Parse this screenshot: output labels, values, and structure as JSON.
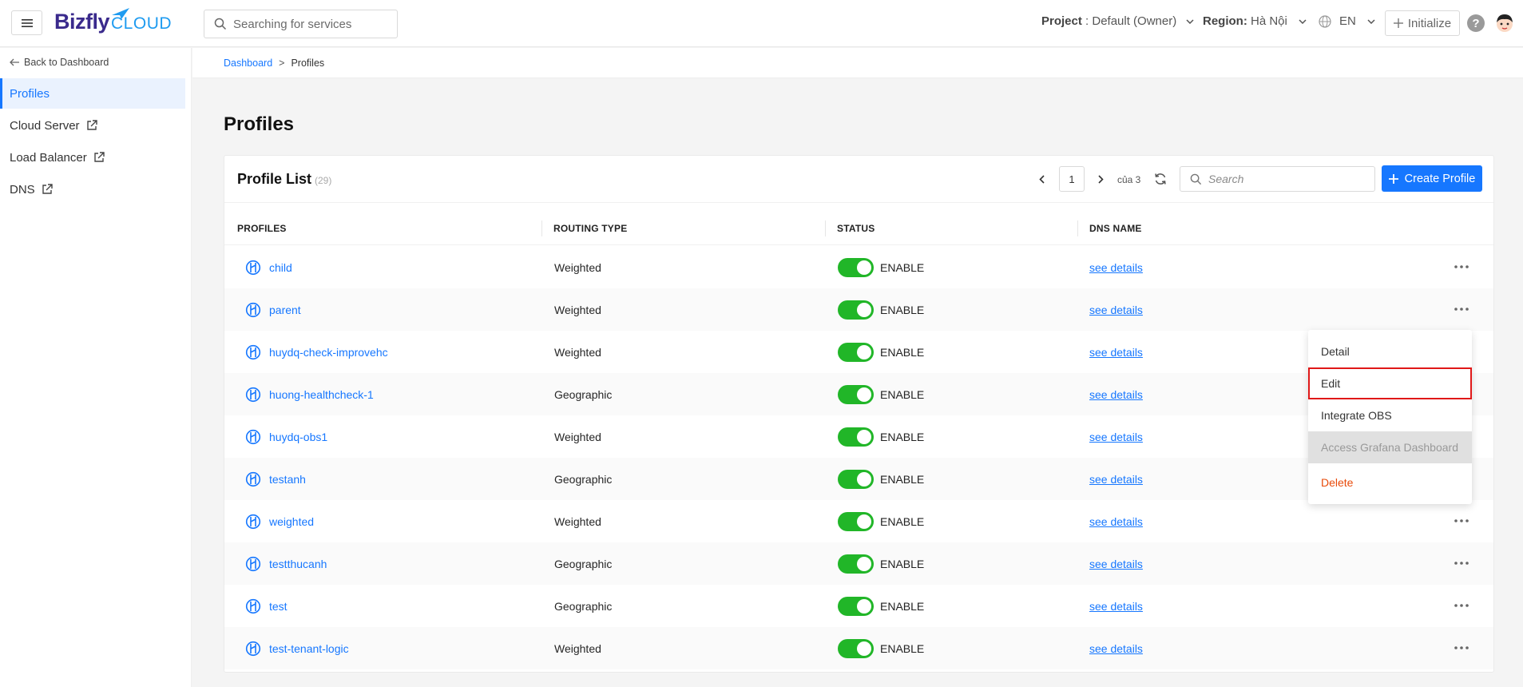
{
  "header": {
    "logo_main": "Bizfly",
    "logo_sub": "CLOUD",
    "search_placeholder": "Searching for services",
    "project_label": "Project",
    "project_value": " : Default (Owner)",
    "region_label": "Region:",
    "region_value": " Hà Nội",
    "language": "EN",
    "initialize_label": "Initialize"
  },
  "sidebar": {
    "back_label": "Back to Dashboard",
    "items": [
      {
        "label": "Profiles",
        "external": false,
        "active": true
      },
      {
        "label": "Cloud Server",
        "external": true,
        "active": false
      },
      {
        "label": "Load Balancer",
        "external": true,
        "active": false
      },
      {
        "label": "DNS",
        "external": true,
        "active": false
      }
    ]
  },
  "breadcrumb": {
    "root": "Dashboard",
    "separator": ">",
    "current": "Profiles"
  },
  "page": {
    "title": "Profiles"
  },
  "list": {
    "title": "Profile List",
    "count": "(29)",
    "current_page": "1",
    "of_text": "của 3",
    "search_placeholder": "Search",
    "create_label": "Create Profile",
    "columns": [
      "PROFILES",
      "ROUTING TYPE",
      "STATUS",
      "DNS NAME"
    ],
    "rows": [
      {
        "name": "child",
        "routing": "Weighted",
        "status": "ENABLE",
        "dns": "see details"
      },
      {
        "name": "parent",
        "routing": "Weighted",
        "status": "ENABLE",
        "dns": "see details"
      },
      {
        "name": "huydq-check-improvehc",
        "routing": "Weighted",
        "status": "ENABLE",
        "dns": "see details"
      },
      {
        "name": "huong-healthcheck-1",
        "routing": "Geographic",
        "status": "ENABLE",
        "dns": "see details"
      },
      {
        "name": "huydq-obs1",
        "routing": "Weighted",
        "status": "ENABLE",
        "dns": "see details"
      },
      {
        "name": "testanh",
        "routing": "Geographic",
        "status": "ENABLE",
        "dns": "see details"
      },
      {
        "name": "weighted",
        "routing": "Weighted",
        "status": "ENABLE",
        "dns": "see details"
      },
      {
        "name": "testthucanh",
        "routing": "Geographic",
        "status": "ENABLE",
        "dns": "see details"
      },
      {
        "name": "test",
        "routing": "Geographic",
        "status": "ENABLE",
        "dns": "see details"
      },
      {
        "name": "test-tenant-logic",
        "routing": "Weighted",
        "status": "ENABLE",
        "dns": "see details"
      }
    ]
  },
  "dropdown": {
    "items": [
      {
        "label": "Detail",
        "state": "normal"
      },
      {
        "label": "Edit",
        "state": "highlighted"
      },
      {
        "label": "Integrate OBS",
        "state": "normal"
      },
      {
        "label": "Access Grafana Dashboard",
        "state": "disabled"
      },
      {
        "label": "Delete",
        "state": "danger"
      }
    ]
  },
  "colors": {
    "primary": "#1677ff",
    "toggle_on": "#21b628",
    "danger": "#e84a0a",
    "highlight_border": "#e01818"
  }
}
